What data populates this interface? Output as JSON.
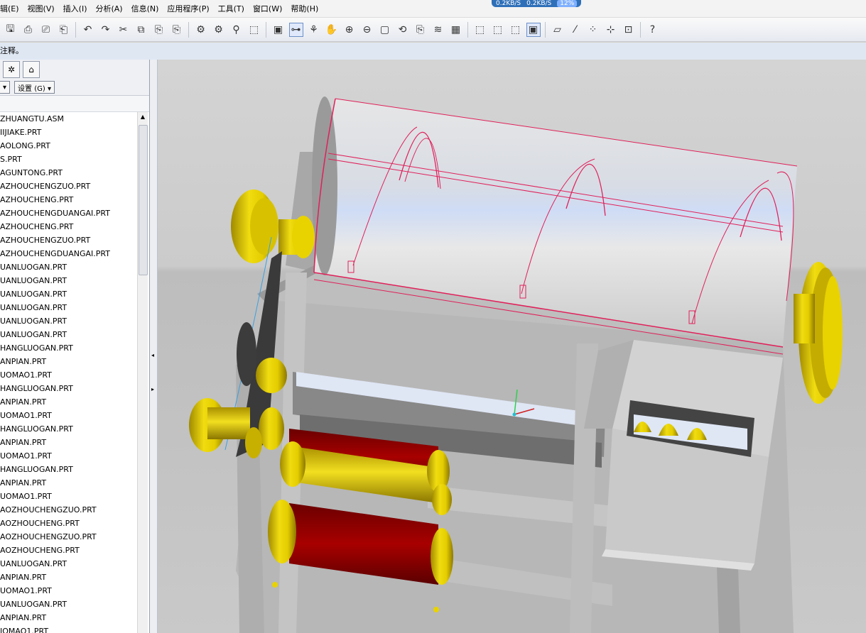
{
  "menu": [
    "辑(E)",
    "视图(V)",
    "插入(I)",
    "分析(A)",
    "信息(N)",
    "应用程序(P)",
    "工具(T)",
    "窗口(W)",
    "帮助(H)"
  ],
  "net_badge": {
    "down": "0.2KB/S",
    "up": "0.2KB/S",
    "percent": "12%"
  },
  "status_message": "注释。",
  "left_panel": {
    "settings_label": "设置 (G) ▾"
  },
  "model_tree": [
    "ZHUANGTU.ASM",
    "IIJIAKE.PRT",
    "AOLONG.PRT",
    "S.PRT",
    "AGUNTONG.PRT",
    "AZHOUCHENGZUO.PRT",
    "AZHOUCHENG.PRT",
    "AZHOUCHENGDUANGAI.PRT",
    "AZHOUCHENG.PRT",
    "AZHOUCHENGZUO.PRT",
    "AZHOUCHENGDUANGAI.PRT",
    "UANLUOGAN.PRT",
    "UANLUOGAN.PRT",
    "UANLUOGAN.PRT",
    "UANLUOGAN.PRT",
    "UANLUOGAN.PRT",
    "UANLUOGAN.PRT",
    "HANGLUOGAN.PRT",
    "ANPIAN.PRT",
    "UOMAO1.PRT",
    "HANGLUOGAN.PRT",
    "ANPIAN.PRT",
    "UOMAO1.PRT",
    "HANGLUOGAN.PRT",
    "ANPIAN.PRT",
    "UOMAO1.PRT",
    "HANGLUOGAN.PRT",
    "ANPIAN.PRT",
    "UOMAO1.PRT",
    "AOZHOUCHENGZUO.PRT",
    "AOZHOUCHENG.PRT",
    "AOZHOUCHENGZUO.PRT",
    "AOZHOUCHENG.PRT",
    "UANLUOGAN.PRT",
    "ANPIAN.PRT",
    "UOMAO1.PRT",
    "UANLUOGAN.PRT",
    "ANPIAN.PRT",
    "IOMAO1.PRT"
  ],
  "toolbar_icons": [
    "save-icon",
    "print-icon",
    "preview-icon",
    "print-setup-icon",
    "undo-icon",
    "redo-icon",
    "cut-icon",
    "copy-icon",
    "paste-icon",
    "paste-special-icon",
    "regenerate-icon",
    "regenerate-manager-icon",
    "find-icon",
    "select-box-icon",
    "repaint-icon",
    "spin-center-icon",
    "orient-mode-icon",
    "pan-icon",
    "zoom-in-icon",
    "zoom-out-icon",
    "refit-icon",
    "reorient-icon",
    "saved-views-icon",
    "layers-icon",
    "model-display-icon",
    "wireframe-icon",
    "hidden-line-icon",
    "no-hidden-icon",
    "shading-icon",
    "datum-planes-icon",
    "datum-axes-icon",
    "datum-points-icon",
    "coord-sys-icon",
    "annotations-icon",
    "context-help-icon"
  ],
  "colors": {
    "gold": "#e8d200",
    "red": "#8b0000",
    "pink_edge": "#e0205a",
    "frame": "#b4b4b4"
  }
}
